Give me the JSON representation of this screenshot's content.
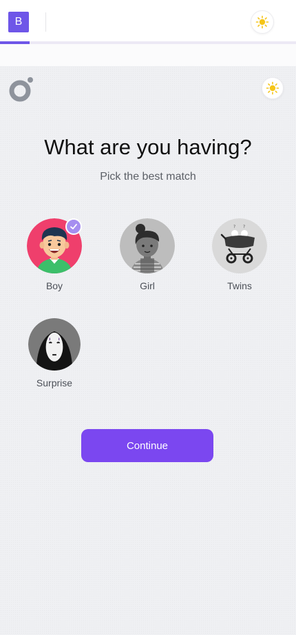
{
  "header": {
    "brand_letter": "B",
    "progress_fraction": 0.1
  },
  "page": {
    "title": "What are you having?",
    "subtitle": "Pick the best match"
  },
  "options": [
    {
      "label": "Boy",
      "icon": "boy-avatar",
      "selected": true
    },
    {
      "label": "Girl",
      "icon": "girl-avatar",
      "selected": false
    },
    {
      "label": "Twins",
      "icon": "twins-stroller-avatar",
      "selected": false
    },
    {
      "label": "Surprise",
      "icon": "masked-face-avatar",
      "selected": false
    }
  ],
  "actions": {
    "continue_label": "Continue"
  },
  "colors": {
    "accent": "#6e56e8",
    "button": "#7b47f0",
    "selected_badge": "#a58ff0",
    "boy_background": "#ef3f6c"
  }
}
